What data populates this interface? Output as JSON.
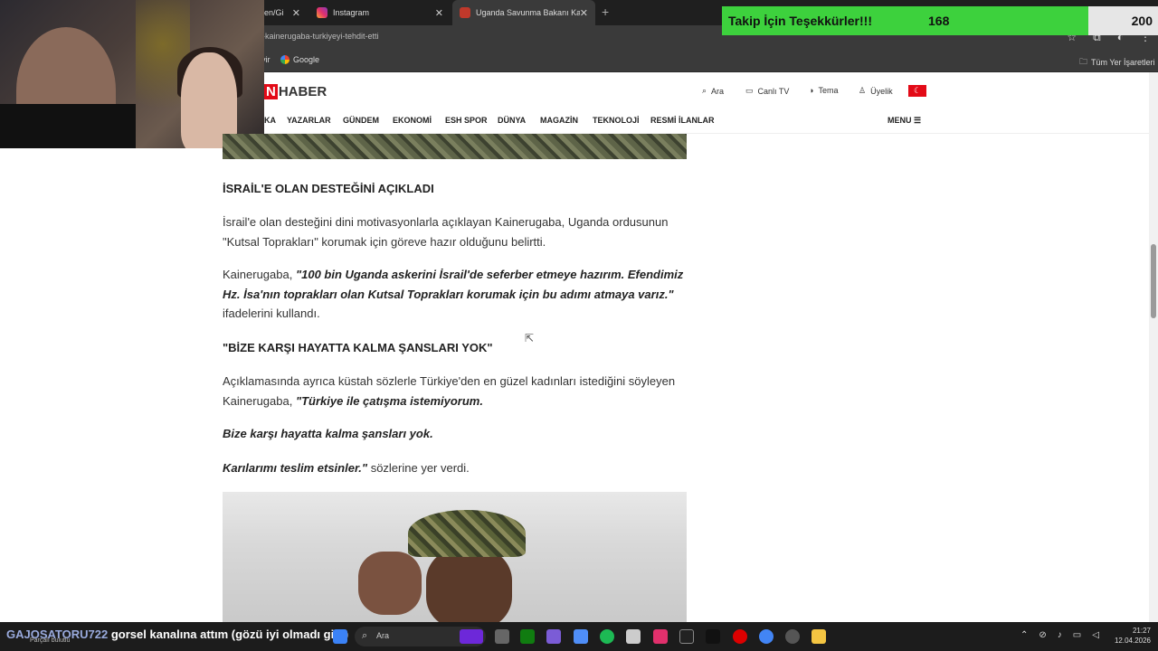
{
  "tabs": [
    {
      "label": "len/Gi"
    },
    {
      "label": "Instagram"
    },
    {
      "label": "Uganda Savunma Bakanı Kaine"
    }
  ],
  "address": {
    "url": "-kainerugaba-turkiyeyi-tehdit-etti"
  },
  "bookmarks": {
    "partial": "vir",
    "google": "Google",
    "all": "Tüm Yer İşaretleri"
  },
  "follow": {
    "label": "Takip İçin Teşekkürler!!!",
    "count": "168",
    "goal": "200",
    "progress": 0.84
  },
  "site": {
    "logo_letter": "N",
    "logo_text": "HABER",
    "nav": {
      "search": "Ara",
      "live": "Canlı TV",
      "theme": "Tema",
      "member": "Üyelik"
    },
    "menu": [
      "KA",
      "YAZARLAR",
      "GÜNDEM",
      "EKONOMİ",
      "ESH SPOR",
      "DÜNYA",
      "MAGAZİN",
      "TEKNOLOJİ",
      "RESMİ İLANLAR"
    ],
    "menu_right": "MENU"
  },
  "article": {
    "h1": "İSRAİL'E OLAN DESTEĞİNİ AÇIKLADI",
    "p1": "İsrail'e olan desteğini dini motivasyonlarla açıklayan Kainerugaba, Uganda ordusunun \"Kutsal Toprakları\" korumak için göreve hazır olduğunu belirtti.",
    "p2_pre": "Kainerugaba, ",
    "p2_quote": "\"100 bin Uganda askerini İsrail'de seferber etmeye hazırım. Efendimiz Hz. İsa'nın toprakları olan Kutsal Toprakları korumak için bu adımı atmaya varız.\"",
    "p2_post": " ifadelerini kullandı.",
    "h2": "\"BİZE KARŞI HAYATTA KALMA ŞANSLARI YOK\"",
    "p3_pre": "Açıklamasında ayrıca küstah sözlerle Türkiye'den en güzel kadınları istediğini söyleyen Kainerugaba, ",
    "p3_quote": "\"Türkiye ile çatışma istemiyorum.",
    "p4_quote": "Bize karşı hayatta kalma şansları yok.",
    "p5_quote": "Karılarımı teslim etsinler.\"",
    "p5_post": " sözlerine yer verdi."
  },
  "taskbar": {
    "chat_user": "GAJOSATORU722",
    "chat_msg": "gorsel kanalına attım (gözü iyi olmadı gibi)",
    "chat_sub": "Parçalı bulutlu",
    "search": "Ara",
    "time": "21:27",
    "date": "12.04.2026"
  },
  "colors": {
    "brand_red": "#e30a17",
    "follow_green": "#3dd13d"
  }
}
